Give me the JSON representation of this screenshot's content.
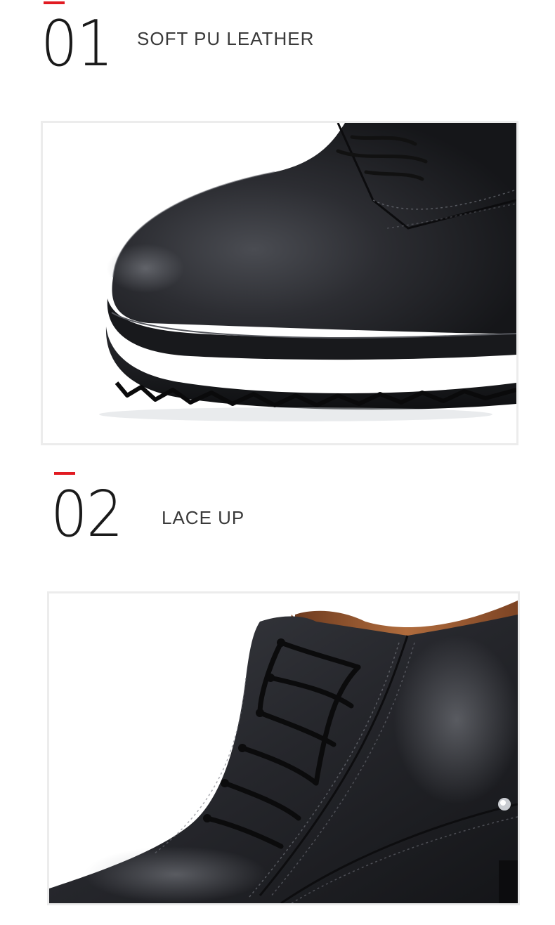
{
  "colors": {
    "accent": "#e11b22",
    "leather": "#2a2b2f",
    "sole": "#1a1b1e",
    "fur": "#a8663c"
  },
  "features": [
    {
      "number": "01",
      "title": "SOFT PU LEATHER",
      "image_subject": "black leather lace-up boot toe close-up"
    },
    {
      "number": "02",
      "title": "LACE UP",
      "image_subject": "black leather boot with fur lining and laces close-up"
    }
  ]
}
